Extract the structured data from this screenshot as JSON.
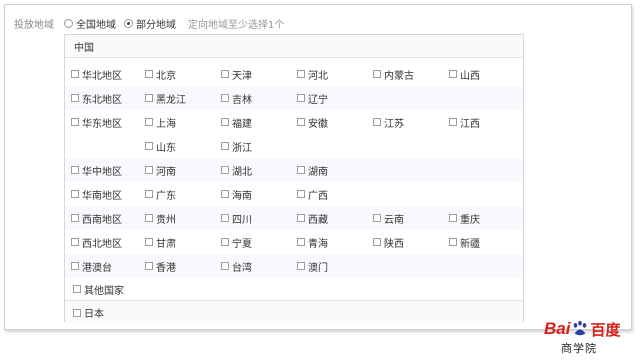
{
  "form": {
    "label": "投放地域",
    "options": [
      {
        "label": "全国地域",
        "checked": false
      },
      {
        "label": "部分地域",
        "checked": true
      }
    ],
    "hint": "定向地域至少选择1个"
  },
  "china": {
    "title": "中国",
    "regions": [
      {
        "name": "华北地区",
        "provinces": [
          "北京",
          "天津",
          "河北",
          "内蒙古",
          "山西"
        ]
      },
      {
        "name": "东北地区",
        "provinces": [
          "黑龙江",
          "吉林",
          "辽宁"
        ]
      },
      {
        "name": "华东地区",
        "provinces": [
          "上海",
          "福建",
          "安徽",
          "江苏",
          "江西",
          "山东",
          "浙江"
        ]
      },
      {
        "name": "华中地区",
        "provinces": [
          "河南",
          "湖北",
          "湖南"
        ]
      },
      {
        "name": "华南地区",
        "provinces": [
          "广东",
          "海南",
          "广西"
        ]
      },
      {
        "name": "西南地区",
        "provinces": [
          "贵州",
          "四川",
          "西藏",
          "云南",
          "重庆"
        ]
      },
      {
        "name": "西北地区",
        "provinces": [
          "甘肃",
          "宁夏",
          "青海",
          "陕西",
          "新疆"
        ]
      },
      {
        "name": "港澳台",
        "provinces": [
          "香港",
          "台湾",
          "澳门"
        ]
      }
    ]
  },
  "others": [
    {
      "label": "其他国家"
    },
    {
      "label": "日本"
    }
  ],
  "logo": {
    "brand_left": "Bai",
    "brand_right": "百度",
    "sub": "商学院",
    "color": "#d6201b"
  }
}
